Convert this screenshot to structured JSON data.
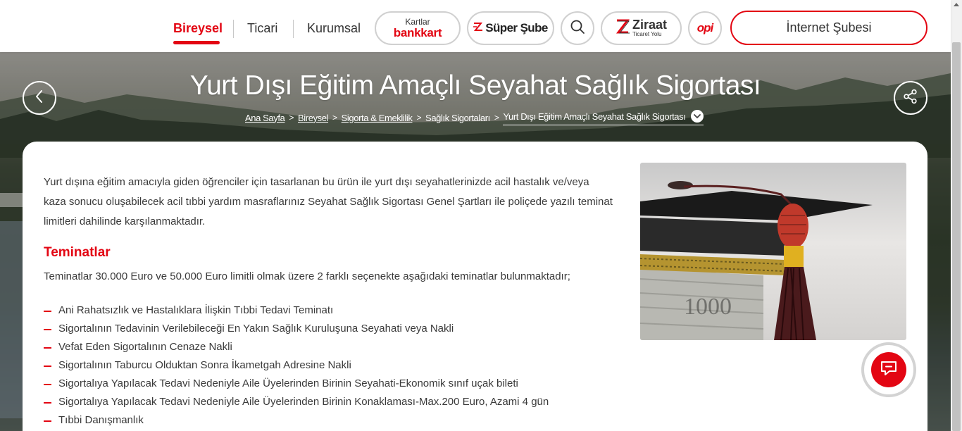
{
  "header": {
    "nav": [
      "Bireysel",
      "Ticari",
      "Kurumsal"
    ],
    "bankkart": {
      "top": "Kartlar",
      "bottom": "bankkart"
    },
    "super_sube": "Süper Şube",
    "ziraat": {
      "name": "Ziraat",
      "sub": "Ticaret Yolu"
    },
    "opi": "opi",
    "internet_subesi": "İnternet Şubesi"
  },
  "hero": {
    "title": "Yurt Dışı Eğitim Amaçlı Seyahat Sağlık Sigortası",
    "breadcrumb": [
      "Ana Sayfa",
      "Bireysel",
      "Sigorta & Emeklilik",
      "Sağlık Sigortaları",
      "Yurt Dışı Eğitim Amaçlı Seyahat Sağlık Sigortası"
    ]
  },
  "content": {
    "intro": "Yurt dışına eğitim amacıyla giden öğrenciler için tasarlanan bu ürün ile yurt dışı seyahatlerinizde acil hastalık ve/veya kaza sonucu oluşabilecek acil tıbbi yardım masraflarınız Seyahat Sağlık Sigortası Genel Şartları ile poliçede yazılı teminat limitleri dahilinde karşılanmaktadır.",
    "section_title": "Teminatlar",
    "section_desc": "Teminatlar 30.000 Euro ve 50.000 Euro limitli olmak üzere 2 farklı seçenekte aşağıdaki teminatlar bulunmaktadır;",
    "items": [
      "Ani Rahatsızlık ve Hastalıklara İlişkin Tıbbi Tedavi Teminatı",
      "Sigortalının Tedavinin Verilebileceği En Yakın Sağlık Kuruluşuna Seyahati veya Nakli",
      "Vefat Eden Sigortalının Cenaze Nakli",
      "Sigortalının Taburcu Olduktan Sonra İkametgah Adresine Nakli",
      "Sigortalıya Yapılacak Tedavi Nedeniyle Aile Üyelerinden Birinin Seyahati-Ekonomik sınıf uçak bileti",
      "Sigortalıya Yapılacak Tedavi Nedeniyle Aile Üyelerinden Birinin Konaklaması-Max.200 Euro, Azami 4 gün",
      "Tıbbi Danışmanlık"
    ],
    "photo_banknote": "1000"
  },
  "colors": {
    "brand_red": "#e30613"
  },
  "icons": {
    "search": "search-icon",
    "back": "chevron-left-icon",
    "share": "share-icon",
    "breadcrumb_dropdown": "chevron-down-icon",
    "chat": "chat-icon"
  }
}
